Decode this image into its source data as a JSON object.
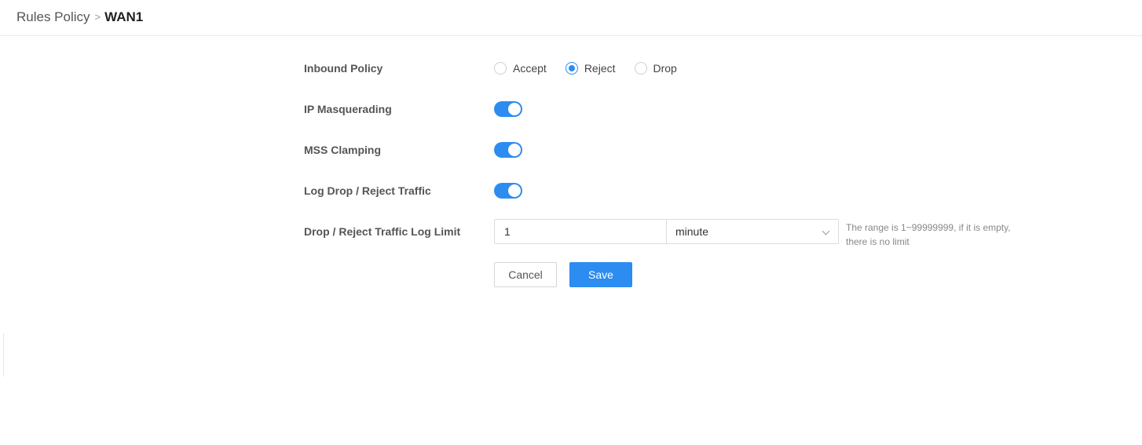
{
  "breadcrumb": {
    "parent": "Rules Policy",
    "separator": ">",
    "current": "WAN1"
  },
  "form": {
    "inbound_policy": {
      "label": "Inbound Policy",
      "options": [
        {
          "label": "Accept",
          "checked": false
        },
        {
          "label": "Reject",
          "checked": true
        },
        {
          "label": "Drop",
          "checked": false
        }
      ]
    },
    "ip_masquerading": {
      "label": "IP Masquerading",
      "enabled": true
    },
    "mss_clamping": {
      "label": "MSS Clamping",
      "enabled": true
    },
    "log_drop_reject": {
      "label": "Log Drop / Reject Traffic",
      "enabled": true
    },
    "log_limit": {
      "label": "Drop / Reject Traffic Log Limit",
      "value": "1",
      "unit": "minute",
      "hint": "The range is 1~99999999, if it is empty, there is no limit"
    }
  },
  "actions": {
    "cancel_label": "Cancel",
    "save_label": "Save"
  },
  "colors": {
    "accent": "#2d8cf0",
    "border": "#dcdcdc",
    "label": "#555555"
  }
}
